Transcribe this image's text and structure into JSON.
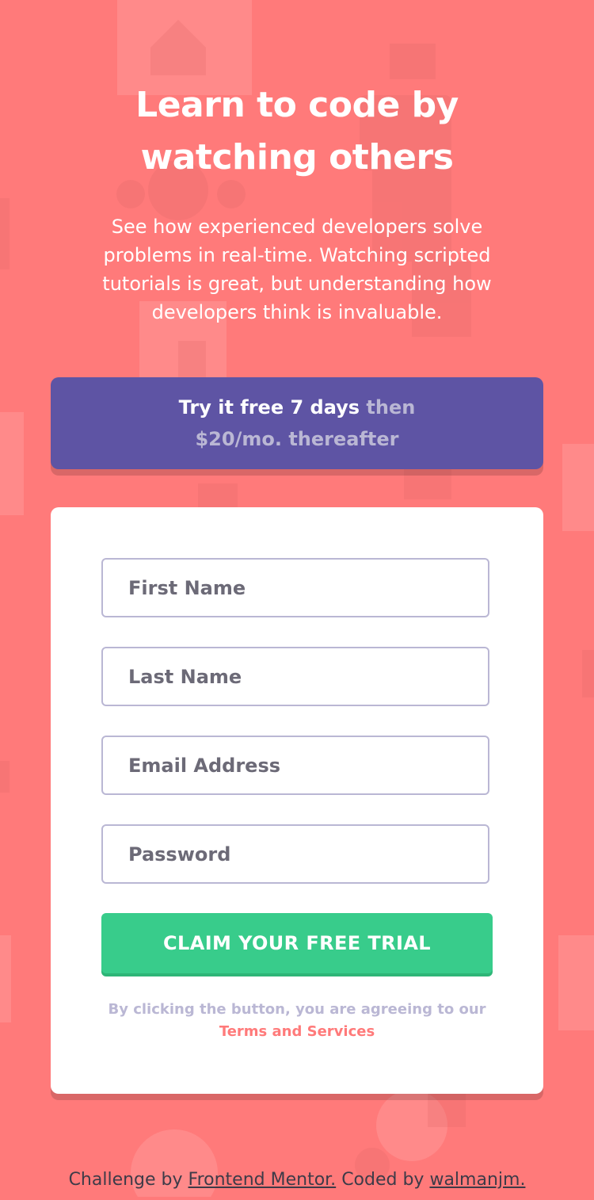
{
  "hero": {
    "title": "Learn to code by watching others",
    "description": "See how experienced developers solve problems in real-time. Watching scripted tutorials is great, but understanding how developers think is invaluable."
  },
  "promo": {
    "strong": "Try it free 7 days",
    "muted": " then $20/mo. thereafter"
  },
  "form": {
    "fields": [
      {
        "placeholder": "First Name"
      },
      {
        "placeholder": "Last Name"
      },
      {
        "placeholder": "Email Address"
      },
      {
        "placeholder": "Password"
      }
    ],
    "submit_label": "CLAIM YOUR FREE TRIAL",
    "terms_prefix": "By clicking the button, you are agreeing to our",
    "terms_link": "Terms and Services"
  },
  "footer": {
    "prefix": "Challenge by",
    "mentor_link": "Frontend Mentor.",
    "middle": "Coded by",
    "author_link": "walmanjm."
  },
  "colors": {
    "background": "#ff7a7a",
    "promo": "#5e54a4",
    "button": "#38cc8b",
    "muted": "#bab7d4"
  }
}
